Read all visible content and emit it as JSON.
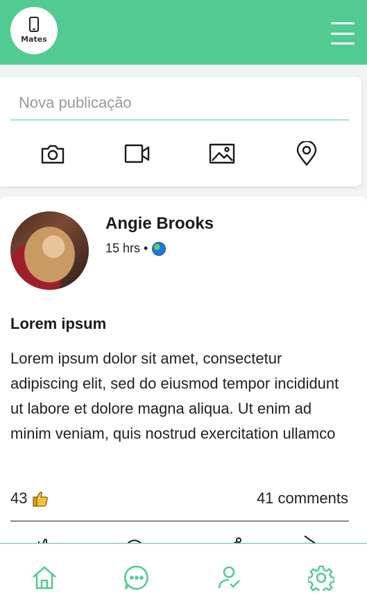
{
  "header": {
    "logo_text": "Mates",
    "logo_icon": "phone-icon",
    "menu_icon": "hamburger-icon",
    "background_color": "#52cb93"
  },
  "composer": {
    "placeholder": "Nova publicação",
    "actions": [
      "camera-icon",
      "video-icon",
      "image-icon",
      "location-icon"
    ]
  },
  "post": {
    "author": "Angie Brooks",
    "time": "15 hrs •",
    "visibility_icon": "globe-icon",
    "title": "Lorem ipsum",
    "body": "Lorem ipsum dolor sit amet, consectetur adipiscing elit, sed do eiusmod tempor incididunt ut labore et dolore magna aliqua. Ut enim ad minim veniam, quis nostrud exercitation ullamco",
    "likes": "43",
    "like_icon": "thumbs-up-icon",
    "comments": "41 comments"
  },
  "bottom_nav": {
    "items": [
      "home-icon",
      "chat-icon",
      "friends-icon",
      "settings-icon"
    ],
    "accent_color": "#52cb93"
  }
}
